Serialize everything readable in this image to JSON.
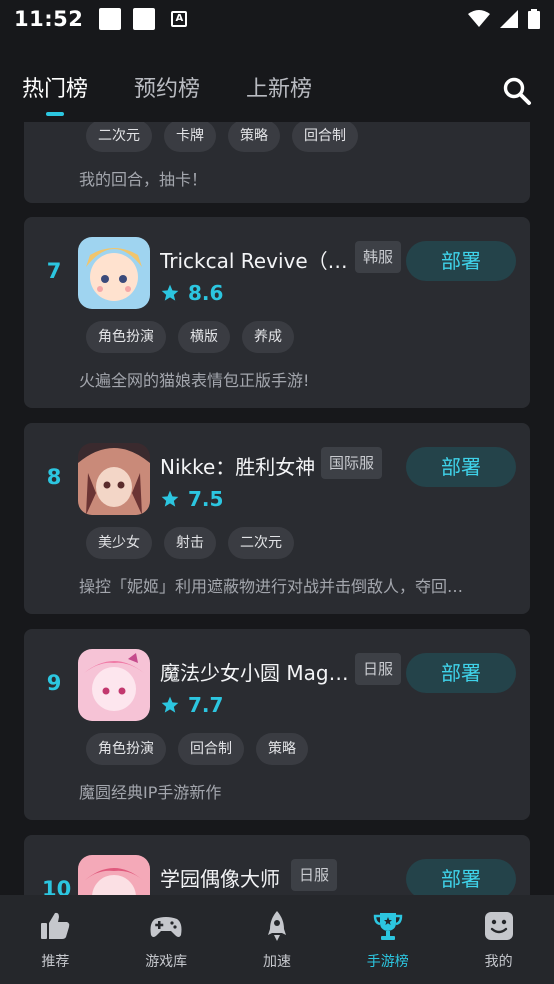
{
  "status_bar": {
    "time": "11:52",
    "notif_badge": "A"
  },
  "tabs": [
    {
      "label": "热门榜",
      "active": true
    },
    {
      "label": "预约榜",
      "active": false
    },
    {
      "label": "上新榜",
      "active": false
    }
  ],
  "list": {
    "partial": {
      "tags": [
        "二次元",
        "卡牌",
        "策略",
        "回合制"
      ],
      "desc": "我的回合，抽卡！"
    },
    "items": [
      {
        "rank": "7",
        "name": "Trickcal Revive（…",
        "region": "韩服",
        "rating": "8.6",
        "tags": [
          "角色扮演",
          "横版",
          "养成"
        ],
        "desc": "火遍全网的猫娘表情包正版手游!",
        "button": "部署"
      },
      {
        "rank": "8",
        "name": "Nikke：胜利女神",
        "region": "国际服",
        "rating": "7.5",
        "tags": [
          "美少女",
          "射击",
          "二次元"
        ],
        "desc": "操控「妮姬」利用遮蔽物进行对战并击倒敌人，夺回…",
        "button": "部署"
      },
      {
        "rank": "9",
        "name": "魔法少女小圆 Magi…",
        "region": "日服",
        "rating": "7.7",
        "tags": [
          "角色扮演",
          "回合制",
          "策略"
        ],
        "desc": "魔圆经典IP手游新作",
        "button": "部署"
      },
      {
        "rank": "10",
        "name": "学园偶像大师",
        "region": "日服",
        "button": "部署"
      }
    ]
  },
  "bottom_nav": [
    {
      "label": "推荐",
      "icon": "thumbs-up-icon",
      "active": false
    },
    {
      "label": "游戏库",
      "icon": "gamepad-icon",
      "active": false
    },
    {
      "label": "加速",
      "icon": "rocket-icon",
      "active": false
    },
    {
      "label": "手游榜",
      "icon": "trophy-icon",
      "active": true
    },
    {
      "label": "我的",
      "icon": "smiley-face-icon",
      "active": false
    }
  ],
  "colors": {
    "accent": "#2cc6e0",
    "card_bg": "#2a2c31",
    "page_bg": "#17181b",
    "button_bg": "#24434a"
  }
}
